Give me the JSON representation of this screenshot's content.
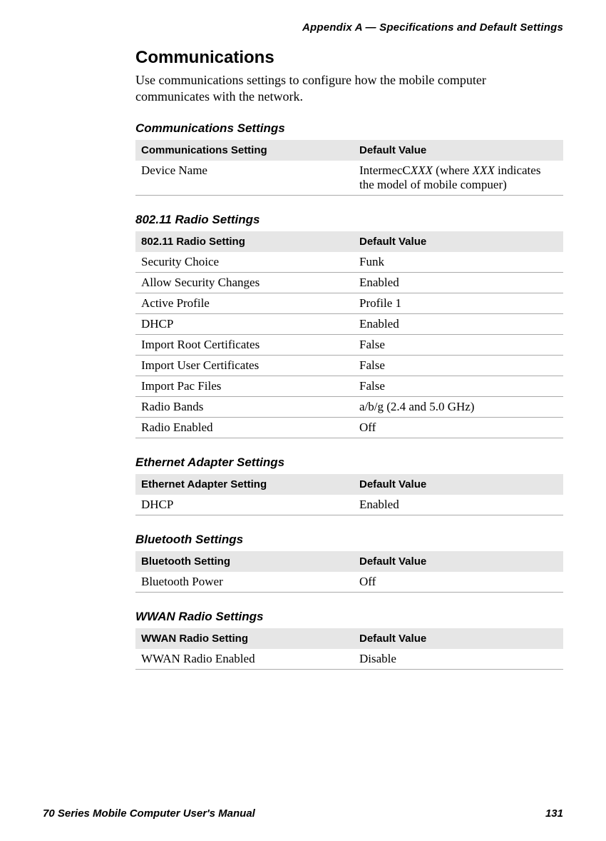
{
  "header": {
    "appendix": "Appendix A — Specifications and Default Settings"
  },
  "section": {
    "title": "Communications",
    "intro": "Use communications settings to configure how the mobile computer communicates with the network."
  },
  "tables": {
    "communications": {
      "title": "Communications Settings",
      "col1": "Communications Setting",
      "col2": "Default Value",
      "rows": [
        {
          "setting": "Device Name",
          "value_prefix": "IntermecC",
          "value_italic1": "XXX",
          "value_mid": " (where ",
          "value_italic2": "XXX",
          "value_suffix": " indicates the model of mobile compuer)"
        }
      ]
    },
    "radio": {
      "title": "802.11 Radio Settings",
      "col1": "802.11 Radio Setting",
      "col2": "Default Value",
      "rows": [
        {
          "setting": "Security Choice",
          "value": "Funk"
        },
        {
          "setting": "Allow Security Changes",
          "value": "Enabled"
        },
        {
          "setting": "Active Profile",
          "value": "Profile 1"
        },
        {
          "setting": "DHCP",
          "value": "Enabled"
        },
        {
          "setting": "Import Root Certificates",
          "value": "False"
        },
        {
          "setting": "Import User Certificates",
          "value": "False"
        },
        {
          "setting": "Import Pac Files",
          "value": "False"
        },
        {
          "setting": "Radio Bands",
          "value": "a/b/g (2.4 and 5.0 GHz)"
        },
        {
          "setting": "Radio Enabled",
          "value": "Off"
        }
      ]
    },
    "ethernet": {
      "title": "Ethernet Adapter Settings",
      "col1": "Ethernet Adapter Setting",
      "col2": "Default Value",
      "rows": [
        {
          "setting": "DHCP",
          "value": "Enabled"
        }
      ]
    },
    "bluetooth": {
      "title": "Bluetooth Settings",
      "col1": "Bluetooth Setting",
      "col2": "Default Value",
      "rows": [
        {
          "setting": "Bluetooth Power",
          "value": "Off"
        }
      ]
    },
    "wwan": {
      "title": "WWAN Radio Settings",
      "col1": "WWAN Radio Setting",
      "col2": "Default Value",
      "rows": [
        {
          "setting": "WWAN Radio Enabled",
          "value": "Disable"
        }
      ]
    }
  },
  "footer": {
    "manual": "70 Series Mobile Computer User's Manual",
    "page": "131"
  }
}
